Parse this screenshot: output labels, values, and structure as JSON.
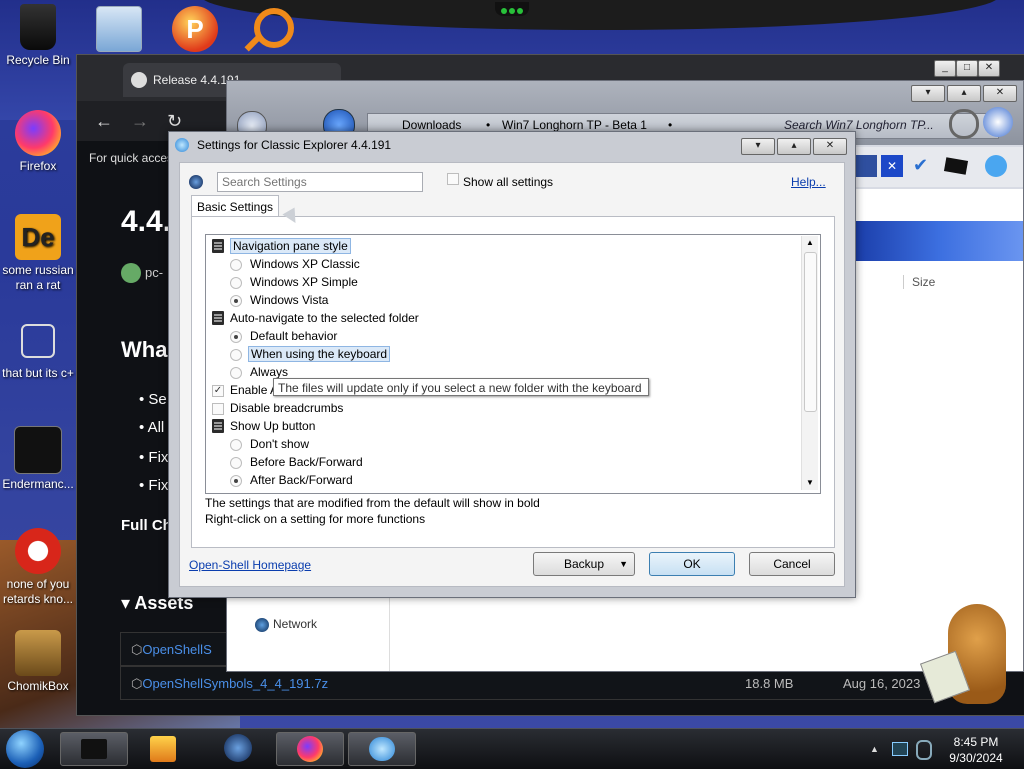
{
  "desktop": {
    "icons": [
      {
        "label": "Recycle Bin",
        "icon": "recycle-bin-icon"
      },
      {
        "label": "Firefox",
        "icon": "firefox-icon"
      },
      {
        "label": "some russian ran a rat",
        "icon": "de-app-icon"
      },
      {
        "label": "that but its c+",
        "icon": "copy-icon"
      },
      {
        "label": "Endermanc...",
        "icon": "terminal-icon"
      },
      {
        "label": "none of you retards kno...",
        "icon": "red-app-icon"
      },
      {
        "label": "ChomikBox",
        "icon": "chomikbox-icon"
      }
    ],
    "top_icons": [
      "pictures-icon",
      "p-app-icon",
      "search-magnifier-icon"
    ]
  },
  "browser": {
    "tab_title": "Release 4.4.191",
    "quick_access": "For quick acces",
    "heading": "4.4.",
    "subline": "pc-",
    "whats_heading": "Wha",
    "bullets": [
      "Se",
      "All",
      "Fix",
      "Fix"
    ],
    "full_changelog": "Full Ch",
    "assets_heading": "Assets",
    "assets": [
      {
        "name": "OpenShellS",
        "size": "",
        "date": ""
      },
      {
        "name": "OpenShellSymbols_4_4_191.7z",
        "size": "18.8 MB",
        "date": "Aug 16, 2023"
      }
    ]
  },
  "explorer": {
    "breadcrumb": [
      "Downloads",
      "Win7 Longhorn TP - Beta 1"
    ],
    "search_placeholder": "Search Win7 Longhorn TP...",
    "column_size": "Size",
    "nav_network": "Network"
  },
  "dialog": {
    "title": "Settings for Classic Explorer 4.4.191",
    "search_placeholder": "Search Settings",
    "show_all": "Show all settings",
    "help": "Help...",
    "tab": "Basic Settings",
    "tree": [
      {
        "type": "group",
        "label": "Navigation pane style",
        "highlight": true
      },
      {
        "type": "radio",
        "label": "Windows XP Classic",
        "checked": false
      },
      {
        "type": "radio",
        "label": "Windows XP Simple",
        "checked": false
      },
      {
        "type": "radio",
        "label": "Windows Vista",
        "checked": true
      },
      {
        "type": "group",
        "label": "Auto-navigate to the selected folder"
      },
      {
        "type": "radio",
        "label": "Default behavior",
        "checked": true
      },
      {
        "type": "radio",
        "label": "When using the keyboard",
        "checked": false,
        "highlight": true
      },
      {
        "type": "radio",
        "label": "Always",
        "checked": false
      },
      {
        "type": "check",
        "label": "Enable A",
        "checked": true
      },
      {
        "type": "check",
        "label": "Disable breadcrumbs",
        "checked": false
      },
      {
        "type": "group",
        "label": "Show Up button"
      },
      {
        "type": "radio",
        "label": "Don't show",
        "checked": false
      },
      {
        "type": "radio",
        "label": "Before Back/Forward",
        "checked": false
      },
      {
        "type": "radio",
        "label": "After Back/Forward",
        "checked": true
      }
    ],
    "tooltip": "The files will update only if you select a new folder with the keyboard",
    "note1": "The settings that are modified from the default will show in bold",
    "note2": "Right-click on a setting for more functions",
    "homepage": "Open-Shell Homepage",
    "backup": "Backup",
    "ok": "OK",
    "cancel": "Cancel"
  },
  "taskbar": {
    "time": "8:45 PM",
    "date": "9/30/2024"
  },
  "colors": {
    "accent": "#3c7fb1",
    "link": "#0a3dae",
    "desktop": "#2c3d9c"
  }
}
